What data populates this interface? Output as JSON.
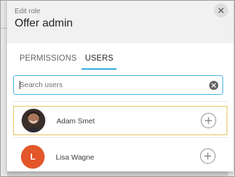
{
  "modal": {
    "caption": "Edit role",
    "title": "Offer admin",
    "close_icon": "close-icon"
  },
  "tabs": [
    {
      "label": "PERMISSIONS",
      "active": false
    },
    {
      "label": "USERS",
      "active": true
    }
  ],
  "search": {
    "placeholder": "Search users",
    "value": "",
    "clear_icon": "clear-icon"
  },
  "users": [
    {
      "name": "Adam Smet",
      "avatar": "photo",
      "selected": true,
      "action_icon": "add-circle-icon"
    },
    {
      "name": "Lisa Wagne",
      "avatar_letter": "L",
      "avatar_color": "#e2562a",
      "selected": false,
      "action_icon": "add-circle-icon"
    }
  ],
  "colors": {
    "accent": "#2da9d8",
    "selected_border": "#e5c45a",
    "header_bg": "#f1f1f1"
  }
}
